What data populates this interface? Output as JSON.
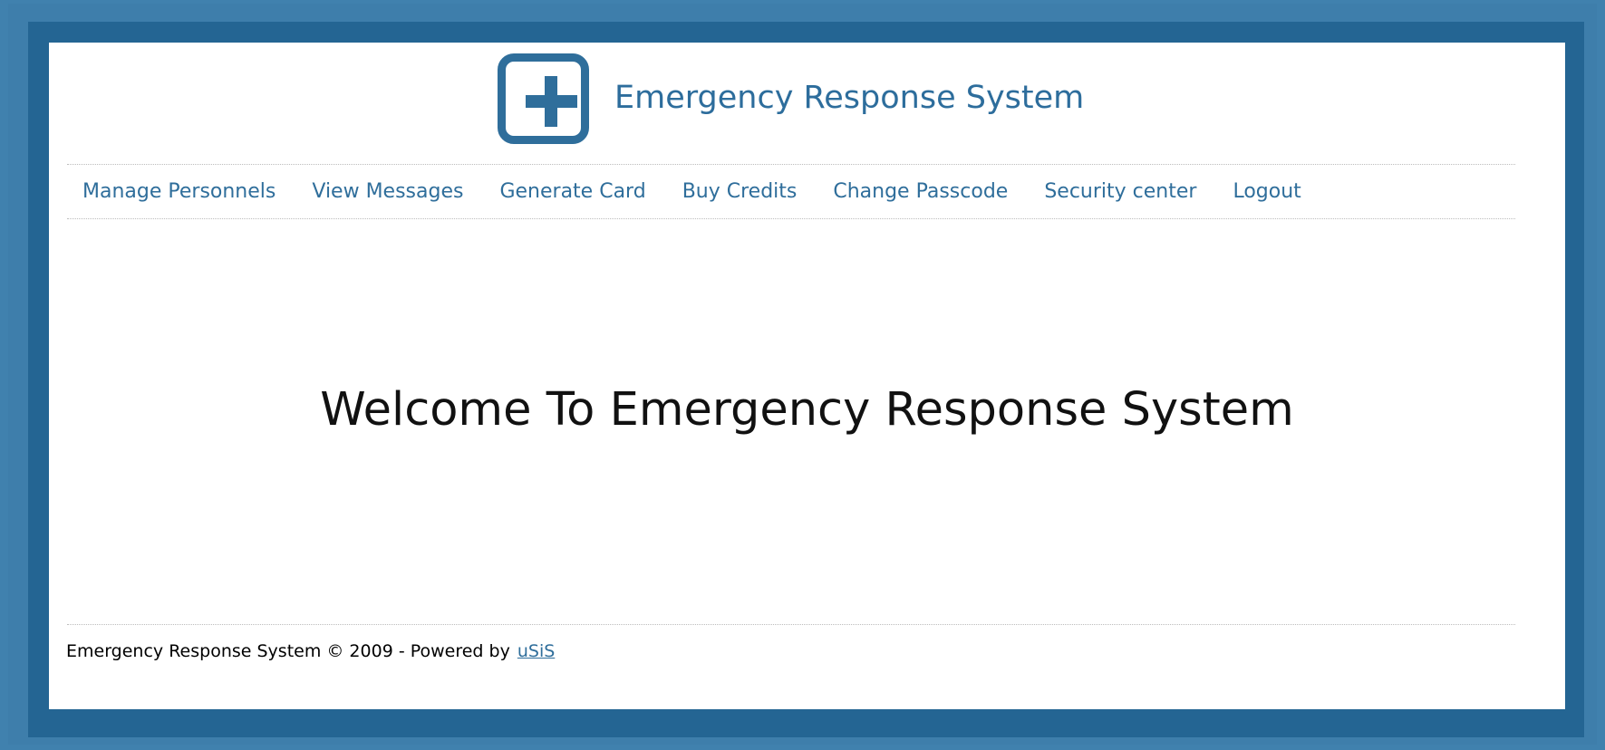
{
  "header": {
    "title": "Emergency Response System",
    "logo_icon": "first-aid-plus-icon"
  },
  "nav": {
    "items": [
      {
        "label": "Manage Personnels"
      },
      {
        "label": "View Messages"
      },
      {
        "label": "Generate Card"
      },
      {
        "label": "Buy Credits"
      },
      {
        "label": "Change Passcode"
      },
      {
        "label": "Security center"
      },
      {
        "label": "Logout"
      }
    ]
  },
  "main": {
    "welcome": "Welcome To Emergency Response System"
  },
  "footer": {
    "text": "Emergency Response System © 2009 - Powered by",
    "link_label": "uSiS"
  },
  "colors": {
    "background": "#4081ae",
    "frame_dark": "#246593",
    "accent": "#2f6e9b",
    "content": "#ffffff"
  }
}
